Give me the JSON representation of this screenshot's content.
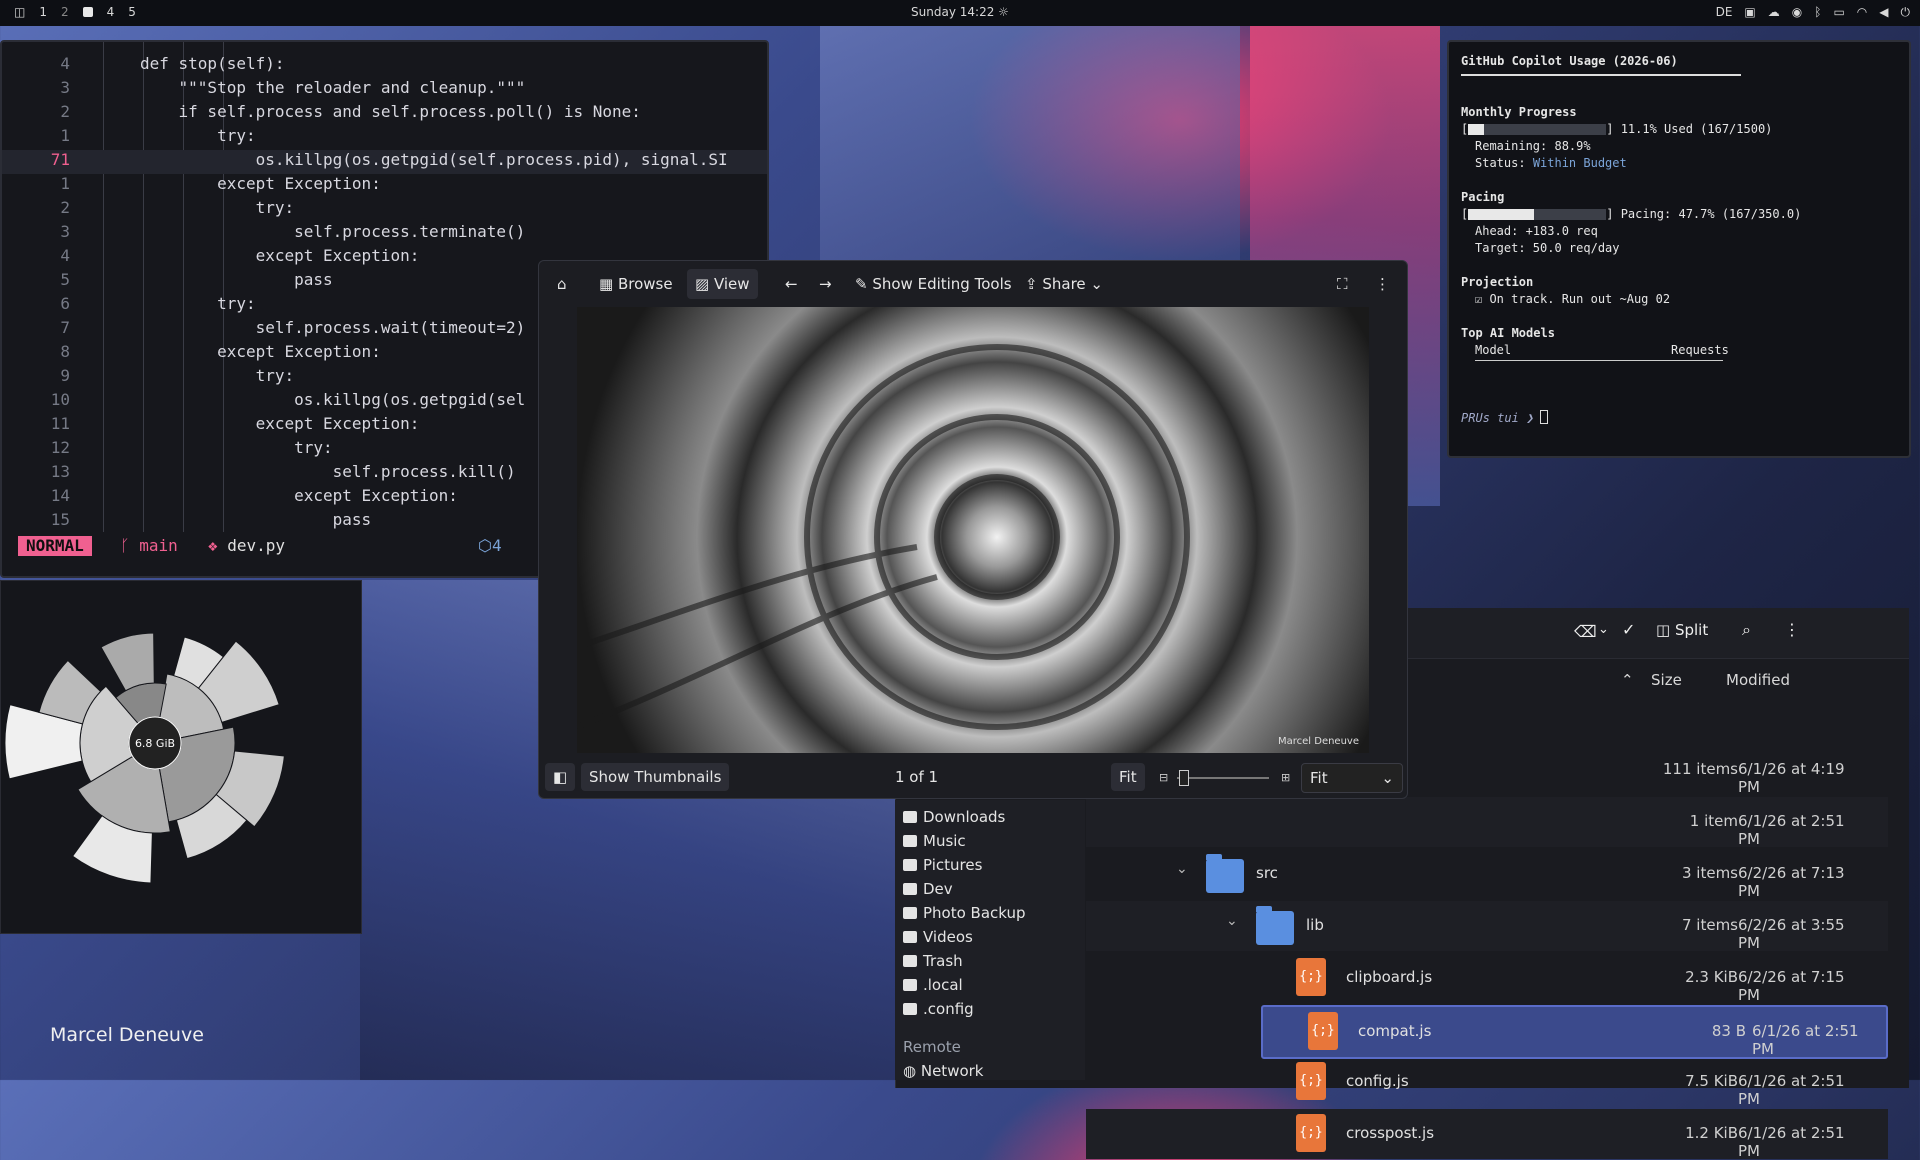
{
  "topbar": {
    "workspaces": [
      "1",
      "2",
      "4",
      "5"
    ],
    "clock": "Sunday 14:22",
    "layout_indicator": "DE"
  },
  "editor": {
    "lines": [
      {
        "n": "4",
        "code": "def stop(self):"
      },
      {
        "n": "3",
        "code": "    \"\"\"Stop the reloader and cleanup.\"\"\""
      },
      {
        "n": "2",
        "code": "    if self.process and self.process.poll() is None:"
      },
      {
        "n": "1",
        "code": "        try:"
      },
      {
        "n": "71",
        "code": "            os.killpg(os.getpgid(self.process.pid), signal.SI"
      },
      {
        "n": "1",
        "code": "        except Exception:"
      },
      {
        "n": "2",
        "code": "            try:"
      },
      {
        "n": "3",
        "code": "                self.process.terminate()"
      },
      {
        "n": "4",
        "code": "            except Exception:"
      },
      {
        "n": "5",
        "code": "                pass"
      },
      {
        "n": "6",
        "code": "        try:"
      },
      {
        "n": "7",
        "code": "            self.process.wait(timeout=2)"
      },
      {
        "n": "8",
        "code": "        except Exception:"
      },
      {
        "n": "9",
        "code": "            try:"
      },
      {
        "n": "10",
        "code": "                os.killpg(os.getpgid(sel"
      },
      {
        "n": "11",
        "code": "            except Exception:"
      },
      {
        "n": "12",
        "code": "                try:"
      },
      {
        "n": "13",
        "code": "                    self.process.kill()"
      },
      {
        "n": "14",
        "code": "                except Exception:"
      },
      {
        "n": "15",
        "code": "                    pass"
      }
    ],
    "status": {
      "mode": "NORMAL",
      "branch": "main",
      "file": "dev.py",
      "diagnostics": "4"
    }
  },
  "disk_usage": {
    "total": "6.8 GiB"
  },
  "copilot": {
    "title": "GitHub Copilot Usage (2026-06)",
    "monthly_heading": "Monthly Progress",
    "monthly_used_text": "11.1% Used (167/1500)",
    "monthly_fraction": 0.111,
    "remaining": "Remaining: 88.9%",
    "status_label": "Status:",
    "status_value": "Within Budget",
    "pacing_heading": "Pacing",
    "pacing_text": "Pacing: 47.7% (167/350.0)",
    "pacing_fraction": 0.477,
    "ahead": "Ahead: +183.0 req",
    "target": "Target: 50.0 req/day",
    "projection_heading": "Projection",
    "projection_text": "On track. Run out ~Aug 02",
    "models_heading": "Top AI Models",
    "col_model": "Model",
    "col_requests": "Requests",
    "prompt": "PRUs tui ❯"
  },
  "viewer": {
    "browse": "Browse",
    "view": "View",
    "edit_tools": "Show Editing Tools",
    "share": "Share",
    "show_thumbnails": "Show Thumbnails",
    "counter": "1 of 1",
    "fit_button": "Fit",
    "fit_select": "Fit",
    "photo_credit": "Marcel Deneuve"
  },
  "file_manager": {
    "split": "Split",
    "columns": {
      "size": "Size",
      "modified": "Modified"
    },
    "rows": [
      {
        "name": "",
        "size": "111 items",
        "modified": "6/1/26 at 4:19 PM",
        "kind": "none",
        "indent": 0
      },
      {
        "name": "",
        "size": "1 item",
        "modified": "6/1/26 at 2:51 PM",
        "kind": "none",
        "indent": 0
      },
      {
        "name": "src",
        "size": "3 items",
        "modified": "6/2/26 at 7:13 PM",
        "kind": "folder",
        "indent": 1
      },
      {
        "name": "lib",
        "size": "7 items",
        "modified": "6/2/26 at 3:55 PM",
        "kind": "folder",
        "indent": 2
      },
      {
        "name": "clipboard.js",
        "size": "2.3 KiB",
        "modified": "6/2/26 at 7:15 PM",
        "kind": "js",
        "indent": 3
      },
      {
        "name": "compat.js",
        "size": "83 B",
        "modified": "6/1/26 at 2:51 PM",
        "kind": "js",
        "indent": 3,
        "selected": true
      },
      {
        "name": "config.js",
        "size": "7.5 KiB",
        "modified": "6/1/26 at 2:51 PM",
        "kind": "js",
        "indent": 3
      },
      {
        "name": "crosspost.js",
        "size": "1.2 KiB",
        "modified": "6/1/26 at 2:51 PM",
        "kind": "js",
        "indent": 3
      }
    ],
    "sidebar": {
      "places": [
        "Downloads",
        "Music",
        "Pictures",
        "Dev",
        "Photo Backup",
        "Videos",
        "Trash",
        ".local",
        ".config"
      ],
      "remote_heading": "Remote",
      "network": "Network"
    }
  },
  "desktop": {
    "credit": "Marcel Deneuve"
  }
}
